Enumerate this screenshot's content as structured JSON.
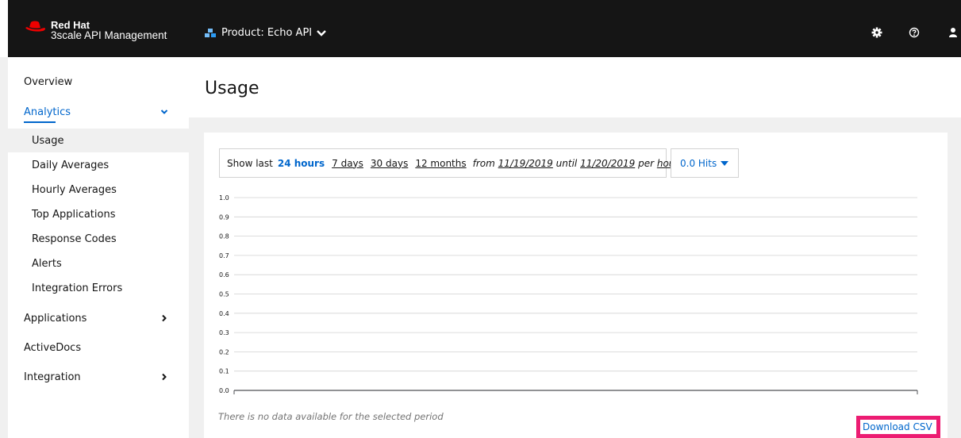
{
  "masthead": {
    "brand_line1": "Red Hat",
    "brand_line2": "3scale API Management",
    "product_label": "Product: Echo API",
    "icons": [
      "gear-icon",
      "help-icon",
      "user-icon"
    ],
    "bg_color": "#151515",
    "brand_color": "#ee0000"
  },
  "sidebar": {
    "overview": "Overview",
    "analytics": "Analytics",
    "analytics_items": [
      "Usage",
      "Daily Averages",
      "Hourly Averages",
      "Top Applications",
      "Response Codes",
      "Alerts",
      "Integration Errors"
    ],
    "applications": "Applications",
    "activedocs": "ActiveDocs",
    "integration": "Integration",
    "active_item": "Usage",
    "accent_color": "#0066cc"
  },
  "main": {
    "title": "Usage",
    "filter": {
      "show_last": "Show last",
      "opt_24h": "24 hours",
      "opt_7d": "7 days",
      "opt_30d": "30 days",
      "opt_12m": "12 months",
      "from": "from",
      "from_date": "11/19/2019",
      "until": "until",
      "until_date": "11/20/2019",
      "per": "per",
      "granularity": "hour",
      "selected": "24 hours"
    },
    "hits_button": "0.0 Hits",
    "no_data": "There is no data available for the selected period",
    "download_csv": "Download CSV",
    "highlight_color": "#ec1c72"
  },
  "chart_data": {
    "type": "line",
    "title": "",
    "xlabel": "",
    "ylabel": "",
    "ylim": [
      0,
      1
    ],
    "y_ticks": [
      "0.0",
      "0.1",
      "0.2",
      "0.3",
      "0.4",
      "0.5",
      "0.6",
      "0.7",
      "0.8",
      "0.9",
      "1.0"
    ],
    "series": [],
    "grid": true
  }
}
